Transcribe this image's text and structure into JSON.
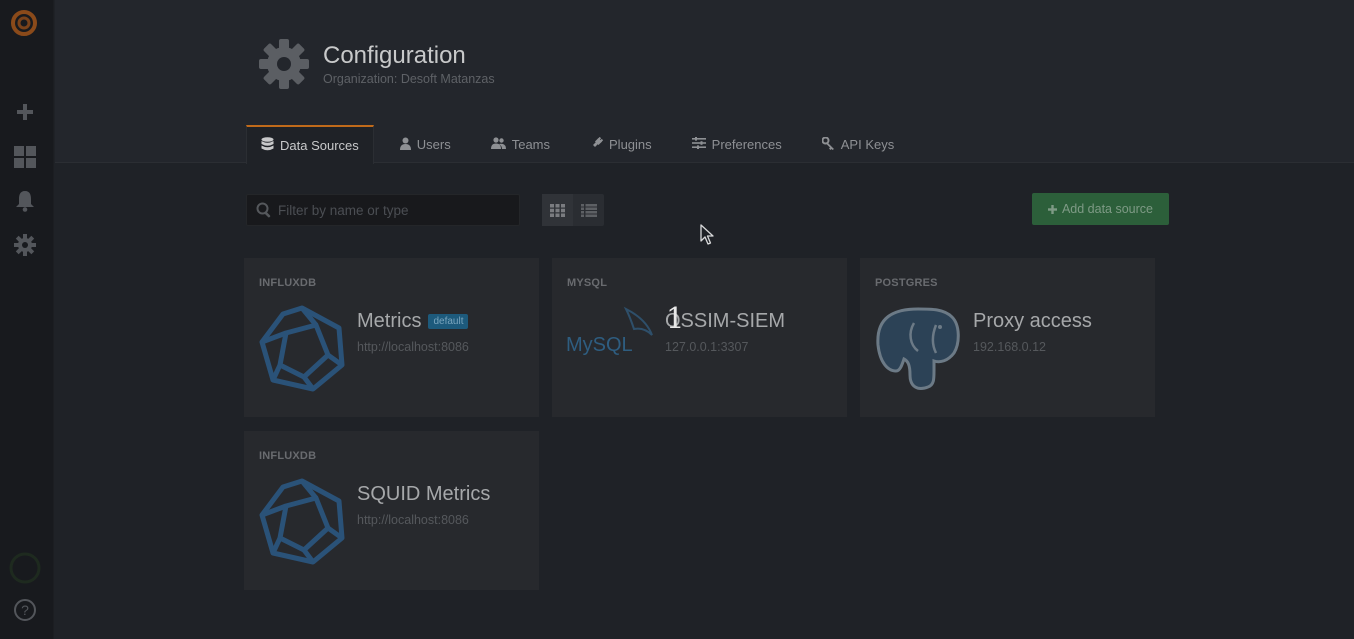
{
  "sidebar": {
    "items": [
      {
        "icon": "grafana-logo-icon"
      },
      {
        "icon": "plus-icon"
      },
      {
        "icon": "dashboards-icon"
      },
      {
        "icon": "bell-icon"
      },
      {
        "icon": "gear-icon"
      },
      {
        "icon": "user-avatar-icon"
      },
      {
        "icon": "help-icon",
        "label": "?"
      }
    ]
  },
  "header": {
    "title": "Configuration",
    "subtitle": "Organization: Desoft Matanzas"
  },
  "tabs": [
    {
      "label": "Data Sources",
      "icon": "database-icon",
      "active": true
    },
    {
      "label": "Users",
      "icon": "user-icon"
    },
    {
      "label": "Teams",
      "icon": "users-icon"
    },
    {
      "label": "Plugins",
      "icon": "plug-icon"
    },
    {
      "label": "Preferences",
      "icon": "sliders-icon"
    },
    {
      "label": "API Keys",
      "icon": "key-icon"
    }
  ],
  "toolbar": {
    "filter_placeholder": "Filter by name or type",
    "add_label": "Add data source",
    "view": "grid"
  },
  "datasources": [
    {
      "type": "INFLUXDB",
      "name": "Metrics",
      "url": "http://localhost:8086",
      "badge": "default",
      "logo": "influxdb-logo-icon"
    },
    {
      "type": "MYSQL",
      "name": "OSSIM-SIEM",
      "url": "127.0.0.1:3307",
      "logo": "mysql-logo-icon",
      "logo_text": "MySQL"
    },
    {
      "type": "POSTGRES",
      "name": "Proxy access",
      "url": "192.168.0.12",
      "logo": "postgres-elephant-icon"
    },
    {
      "type": "INFLUXDB",
      "name": "SQUID Metrics",
      "url": "http://localhost:8086",
      "logo": "influxdb-logo-icon"
    }
  ],
  "overlay": {
    "step_number": "1"
  },
  "colors": {
    "accent": "#c06a1a",
    "add_button": "#2c5f3a",
    "badge": "#1d5a7c",
    "influx": "#2a5278"
  }
}
